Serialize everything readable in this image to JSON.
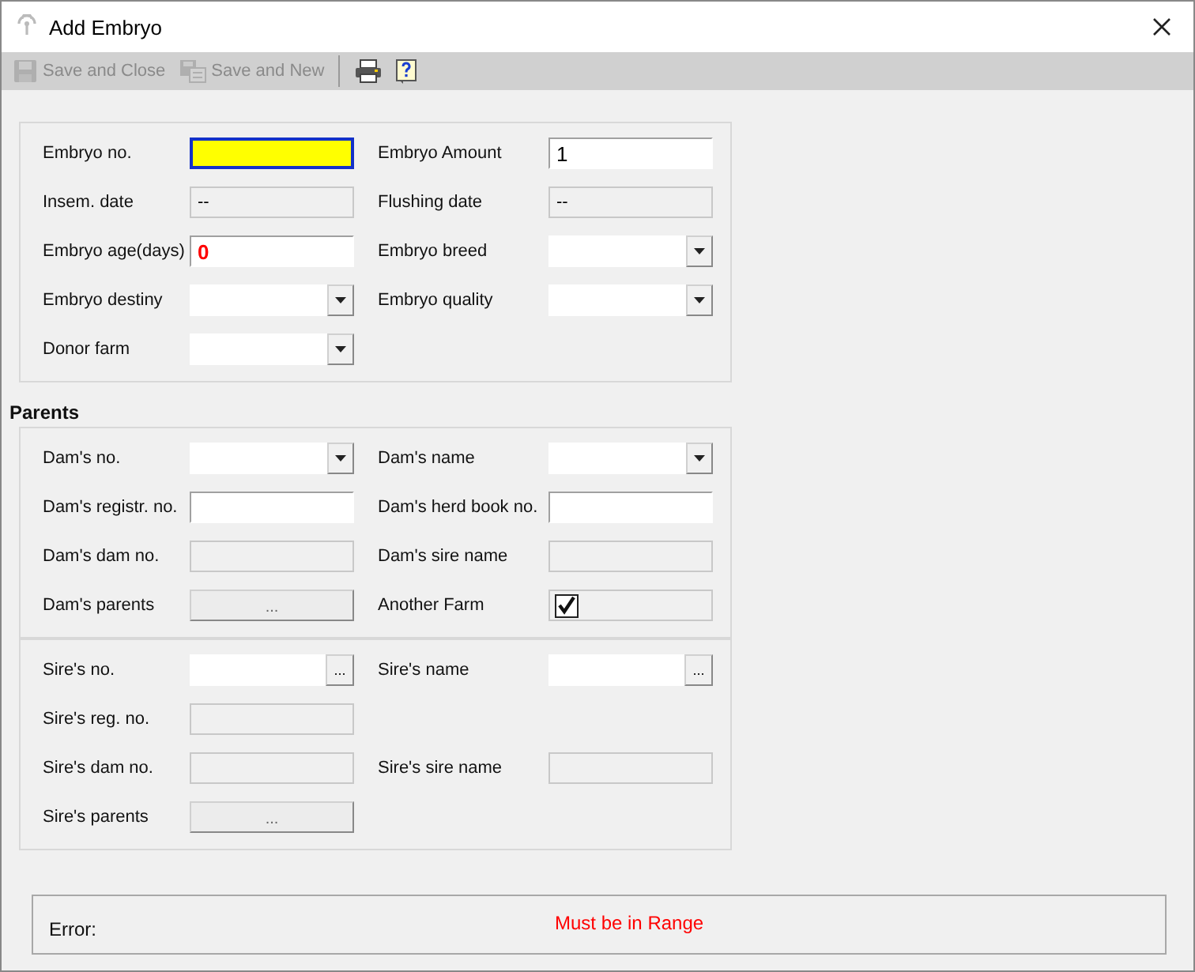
{
  "window": {
    "title": "Add Embryo"
  },
  "toolbar": [
    {
      "kind": "save-close",
      "label": "Save and Close",
      "disabled": true
    },
    {
      "kind": "save-new",
      "label": "Save and New",
      "disabled": true
    },
    {
      "kind": "separator"
    },
    {
      "kind": "print",
      "disabled": false
    },
    {
      "kind": "help",
      "disabled": false
    }
  ],
  "sections": [
    {
      "rows": [
        [
          {
            "label": "Embryo no.",
            "field": {
              "kind": "text",
              "focused": true
            }
          },
          {
            "label": "Embryo Amount",
            "field": {
              "kind": "text",
              "value": "1",
              "focused": false,
              "invalid": false
            }
          }
        ],
        [
          {
            "label": "Insem. date",
            "field": {
              "kind": "readonly",
              "value": "--"
            }
          },
          {
            "label": "Flushing date",
            "field": {
              "kind": "readonly",
              "value": "--"
            }
          }
        ],
        [
          {
            "label": "Embryo age(days)",
            "field": {
              "kind": "text",
              "value": "0",
              "focused": false,
              "invalid": true
            }
          },
          {
            "label": "Embryo breed",
            "field": {
              "kind": "combo"
            }
          }
        ],
        [
          {
            "label": "Embryo destiny",
            "field": {
              "kind": "combo"
            }
          },
          {
            "label": "Embryo quality",
            "field": {
              "kind": "combo"
            }
          }
        ],
        [
          {
            "label": "Donor farm",
            "field": {
              "kind": "combo"
            }
          }
        ]
      ]
    },
    {
      "title": "Parents",
      "rows": [
        [
          {
            "label": "Dam's no.",
            "field": {
              "kind": "combo"
            }
          },
          {
            "label": "Dam's name",
            "field": {
              "kind": "combo"
            }
          }
        ],
        [
          {
            "label": "Dam's registr. no.",
            "field": {
              "kind": "text",
              "focused": false
            }
          },
          {
            "label": "Dam's herd book no.",
            "field": {
              "kind": "text",
              "focused": false
            }
          }
        ],
        [
          {
            "label": "Dam's dam no.",
            "field": {
              "kind": "readonly"
            }
          },
          {
            "label": "Dam's sire name",
            "field": {
              "kind": "readonly"
            }
          }
        ],
        [
          {
            "label": "Dam's parents",
            "field": {
              "kind": "button",
              "label": "..."
            }
          },
          {
            "label": "Another Farm",
            "field": {
              "kind": "checkbox",
              "checked": true
            }
          }
        ]
      ]
    },
    {
      "rows": [
        [
          {
            "label": "Sire's no.",
            "field": {
              "kind": "lookup",
              "button_label": "..."
            }
          },
          {
            "label": "Sire's name",
            "field": {
              "kind": "lookup",
              "button_label": "..."
            }
          }
        ],
        [
          {
            "label": "Sire's reg. no.",
            "field": {
              "kind": "readonly"
            }
          }
        ],
        [
          {
            "label": "Sire's dam no.",
            "field": {
              "kind": "readonly"
            }
          },
          {
            "label": "Sire's sire name",
            "field": {
              "kind": "readonly"
            }
          }
        ],
        [
          {
            "label": "Sire's parents",
            "field": {
              "kind": "button",
              "label": "..."
            }
          }
        ]
      ]
    }
  ],
  "error": {
    "label": "Error:",
    "message": "Must be in Range"
  }
}
